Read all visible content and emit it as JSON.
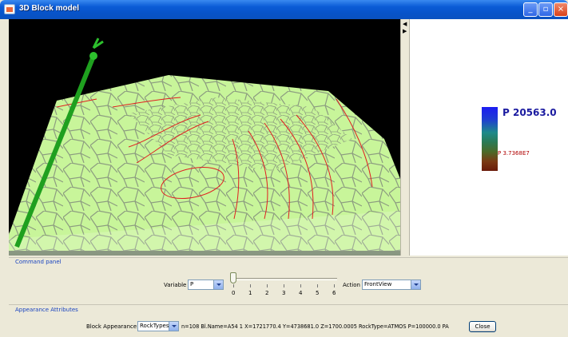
{
  "window": {
    "title": "3D Block model"
  },
  "legend": {
    "max_label": "P 20563.0",
    "min_label": "P 3.7368E7"
  },
  "command_panel": {
    "title": "Command panel",
    "variable_label": "Variable",
    "variable_value": "P",
    "slider": {
      "value": 0,
      "ticks": [
        "0",
        "1",
        "2",
        "3",
        "4",
        "5",
        "6"
      ]
    },
    "action_label": "Action",
    "action_value": "FrontView"
  },
  "appearance_panel": {
    "title": "Appearance Attributes",
    "block_appearance_label": "Block Appearance",
    "block_appearance_value": "RockTypes",
    "info": "n=108  Bl.Name=A54 1  X=1721770.4  Y=4738681.0  Z=1700.0005  RockType=ATMOS  P=100000.0 PA",
    "close_label": "Close"
  },
  "colors": {
    "block_fill": "#C8F59A",
    "contour": "#E02020",
    "axis": "#1FA01F",
    "titlebar": "#0A5BD6"
  }
}
